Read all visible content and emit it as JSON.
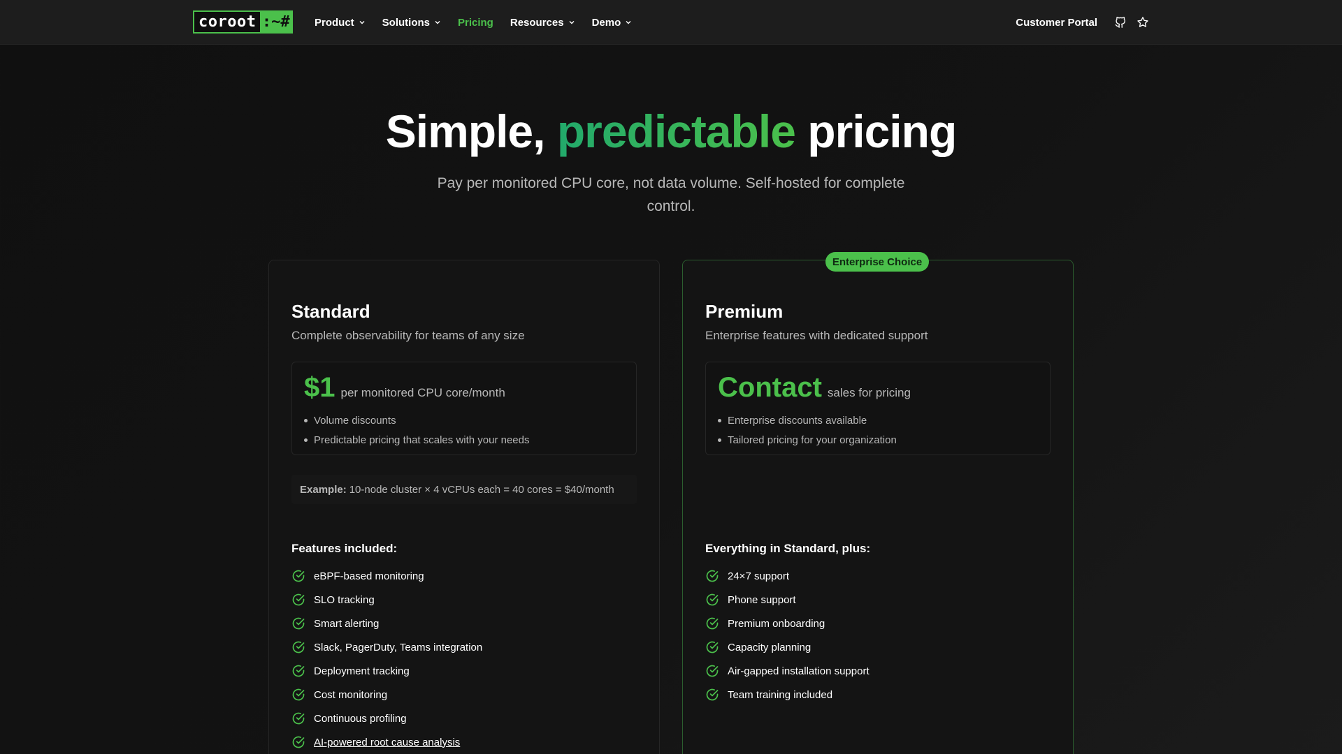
{
  "nav": {
    "logo_left": "coroot",
    "logo_right": ":~#",
    "items": [
      {
        "label": "Product",
        "dropdown": true
      },
      {
        "label": "Solutions",
        "dropdown": true
      },
      {
        "label": "Pricing",
        "dropdown": false,
        "active": true
      },
      {
        "label": "Resources",
        "dropdown": true
      },
      {
        "label": "Demo",
        "dropdown": true
      }
    ],
    "portal": "Customer Portal",
    "icons": [
      "github-icon",
      "star-icon"
    ]
  },
  "hero": {
    "title_pre": "Simple,",
    "title_accent": "predictable",
    "title_post": "pricing",
    "subtitle": "Pay per monitored CPU core, not data volume. Self-hosted for complete control."
  },
  "standard": {
    "title": "Standard",
    "desc": "Complete observability for teams of any size",
    "price": "$1",
    "unit": "per monitored CPU core/month",
    "bullets": [
      "Volume discounts",
      "Predictable pricing that scales with your needs"
    ],
    "example_label": "Example:",
    "example_text": "10-node cluster × 4 vCPUs each = 40 cores = $40/month",
    "features_head": "Features included:",
    "features": [
      "eBPF-based monitoring",
      "SLO tracking",
      "Smart alerting",
      "Slack, PagerDuty, Teams integration",
      "Deployment tracking",
      "Cost monitoring",
      "Continuous profiling",
      "AI-powered root cause analysis"
    ]
  },
  "premium": {
    "badge": "Enterprise Choice",
    "title": "Premium",
    "desc": "Enterprise features with dedicated support",
    "price": "Contact",
    "unit": "sales for pricing",
    "bullets": [
      "Enterprise discounts available",
      "Tailored pricing for your organization"
    ],
    "features_head": "Everything in Standard, plus:",
    "features": [
      "24×7 support",
      "Phone support",
      "Premium onboarding",
      "Capacity planning",
      "Air-gapped installation support",
      "Team training included"
    ]
  },
  "colors": {
    "accent": "#4bc04b",
    "background": "#0f0f0f",
    "text_muted": "#b8b8b8"
  }
}
